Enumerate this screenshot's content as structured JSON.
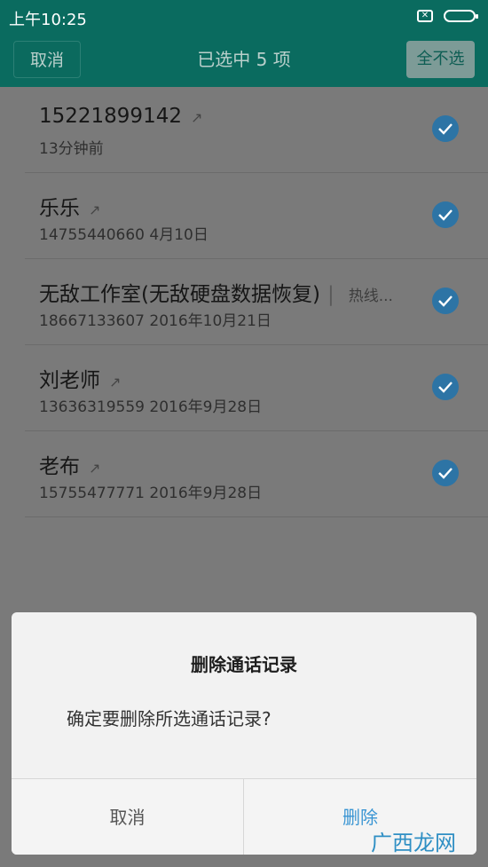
{
  "status_bar": {
    "time": "上午10:25",
    "sim_icon": "sim-off-icon",
    "battery_icon": "battery-icon"
  },
  "app_bar": {
    "cancel_label": "取消",
    "title": "已选中 5 项",
    "deselect_all_label": "全不选"
  },
  "call_log": [
    {
      "name": "15221899142",
      "show_arrow": true,
      "extra": "",
      "detail": "13分钟前",
      "checked": true
    },
    {
      "name": "乐乐",
      "show_arrow": true,
      "extra": "",
      "detail": "14755440660  4月10日",
      "checked": true
    },
    {
      "name": "无敌工作室(无敌硬盘数据恢复)",
      "show_arrow": false,
      "extra": "热线...",
      "detail": "18667133607  2016年10月21日",
      "checked": true
    },
    {
      "name": "刘老师",
      "show_arrow": true,
      "extra": "",
      "detail": "13636319559  2016年9月28日",
      "checked": true
    },
    {
      "name": "老布",
      "show_arrow": true,
      "extra": "",
      "detail": "15755477771  2016年9月28日",
      "checked": true
    }
  ],
  "dialog": {
    "title": "删除通话记录",
    "message": "确定要删除所选通话记录?",
    "cancel_label": "取消",
    "delete_label": "删除"
  },
  "watermark": "广西龙网",
  "colors": {
    "header": "#0a6b5f",
    "check": "#2d74a5",
    "delete": "#3a95d3"
  }
}
